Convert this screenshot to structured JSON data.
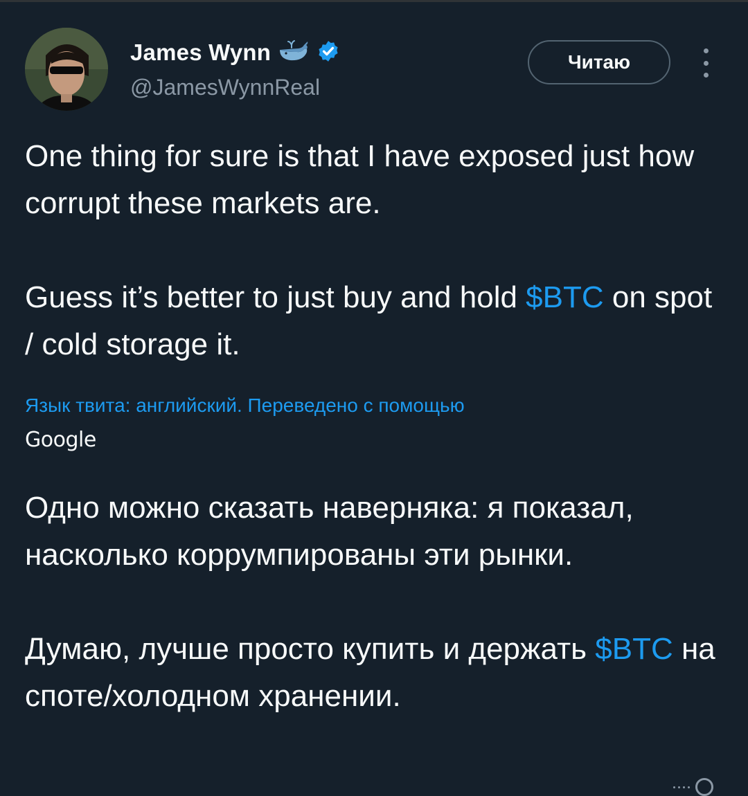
{
  "author": {
    "display_name": "James Wynn",
    "handle": "@JamesWynnReal",
    "name_emoji_icon": "whale-icon",
    "verified_icon": "verified-badge-icon"
  },
  "actions": {
    "follow_label": "Читаю",
    "more_icon": "more-options-icon"
  },
  "tweet": {
    "original_paragraphs": [
      {
        "text": "One thing for sure is that I have exposed just how corrupt these markets are."
      },
      {
        "before": "Guess it’s better to just buy and hold ",
        "cashtag": "$BTC",
        "after": " on spot / cold storage it."
      }
    ],
    "translation_note": "Язык твита: английский. Переведено с помощью",
    "translation_provider": "Google",
    "translated_paragraphs": [
      {
        "text": "Одно можно сказать наверняка: я показал, насколько коррумпированы эти рынки."
      },
      {
        "cashtag_first": "Думаю, лучше просто купить и держать ",
        "cashtag": "$BTC",
        "after": " на споте/холодном хранении."
      }
    ]
  },
  "colors": {
    "background": "#15202b",
    "text_primary": "#f7f9f9",
    "text_secondary": "#8b98a5",
    "accent": "#1d9bf0",
    "border": "#536471"
  }
}
